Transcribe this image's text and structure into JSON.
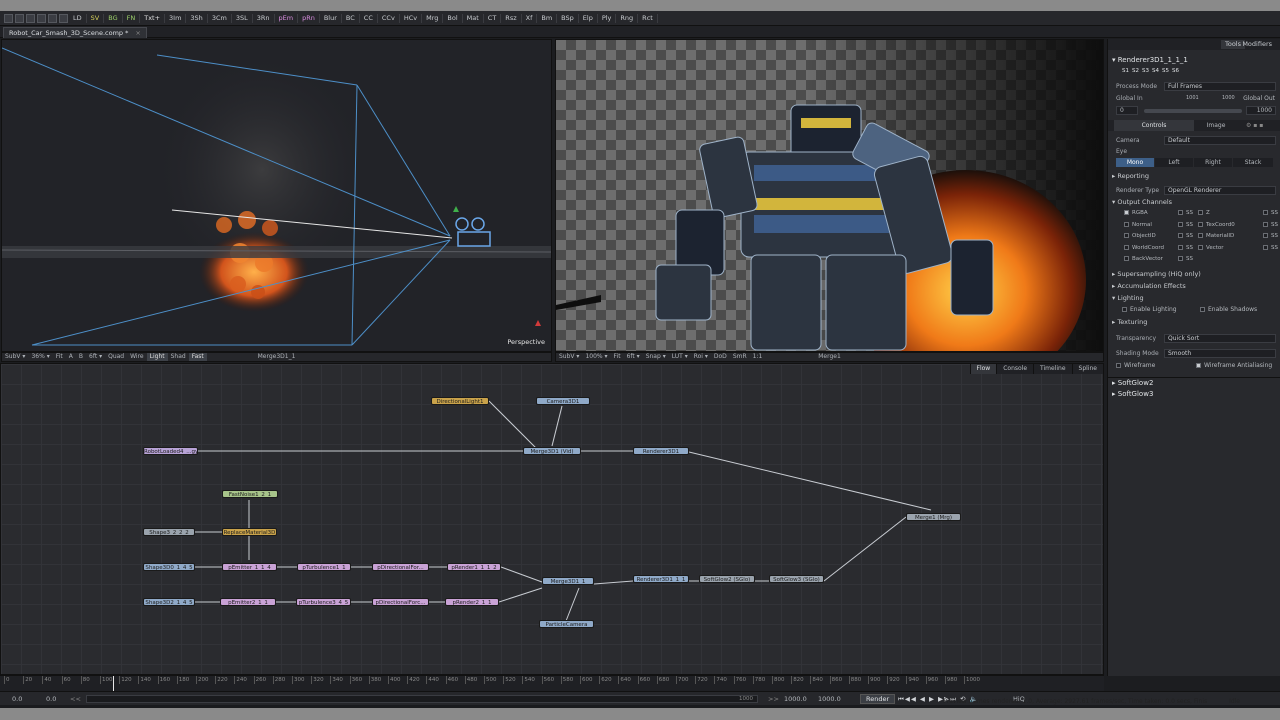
{
  "toolbar": {
    "items": [
      "LD",
      "SV",
      "BG",
      "FN",
      "Txt+",
      "3Im",
      "3Sh",
      "3Cm",
      "3SL",
      "3Rn",
      "pEm",
      "pRn",
      "Blur",
      "BC",
      "CC",
      "CCv",
      "HCv",
      "Mrg",
      "Bol",
      "Mat",
      "CT",
      "Rsz",
      "Xf",
      "Bm",
      "BSp",
      "Elp",
      "Ply",
      "Rng",
      "Rct"
    ]
  },
  "document_tab": {
    "title": "Robot_Car_Smash_3D_Scene.comp *",
    "close": "×"
  },
  "viewer_left": {
    "corner_label": "Perspective",
    "bar": {
      "items": [
        "SubV ▾",
        "36% ▾",
        "Fit",
        "A",
        "B",
        "6ft ▾",
        "Quad",
        "Wire",
        "Light",
        "Shad",
        "Fast"
      ],
      "node": "Merge3D1_1"
    }
  },
  "viewer_right": {
    "bar": {
      "items": [
        "SubV ▾",
        "100% ▾",
        "Fit",
        "6ft ▾",
        "Snap ▾",
        "LUT ▾",
        "Roi ▾",
        "DoD",
        "SmR",
        "1:1"
      ],
      "node": "Merge1"
    }
  },
  "inspector": {
    "tabs": {
      "tools": "Tools",
      "modifiers": "Modifiers"
    },
    "node_name": "Renderer3D1_1_1_1",
    "slots": [
      "S1",
      "S2",
      "S3",
      "S4",
      "S5",
      "S6"
    ],
    "process_mode_label": "Process Mode",
    "process_mode_value": "Full Frames",
    "global_in_label": "Global In",
    "global_out_label": "Global Out",
    "range_start": "0",
    "range_mid": "1001",
    "range_right": "1000",
    "range_end": "1000",
    "sub_tabs": {
      "controls": "Controls",
      "image": "Image"
    },
    "camera_label": "Camera",
    "camera_value": "Default",
    "eye_label": "Eye",
    "eye_options": [
      "Mono",
      "Left",
      "Right",
      "Stack"
    ],
    "reporting": "Reporting",
    "renderer_type_label": "Renderer Type",
    "renderer_type_value": "OpenGL Renderer",
    "output_channels": "Output Channels",
    "channels": [
      [
        "RGBA",
        "SS",
        "Z",
        "SS"
      ],
      [
        "Normal",
        "SS",
        "TexCoord0",
        "SS"
      ],
      [
        "ObjectID",
        "SS",
        "MaterialID",
        "SS"
      ],
      [
        "WorldCoord",
        "SS",
        "Vector",
        "SS"
      ],
      [
        "BackVector",
        "SS",
        "",
        ""
      ]
    ],
    "supersampling": "Supersampling (HiQ only)",
    "accumulation": "Accumulation Effects",
    "lighting": "Lighting",
    "enable_lighting": "Enable Lighting",
    "enable_shadows": "Enable Shadows",
    "texturing": "Texturing",
    "transparency_label": "Transparency",
    "transparency_value": "Quick Sort",
    "shading_label": "Shading Mode",
    "shading_value": "Smooth",
    "wireframe": "Wireframe",
    "wireframe_aa": "Wireframe Antialiasing",
    "other_tools": [
      "SoftGlow2",
      "SoftGlow3"
    ]
  },
  "node_editor": {
    "tabs": [
      "Flow",
      "Console",
      "Timeline",
      "Spline"
    ],
    "nodes": [
      {
        "label": "DirectionalLight1",
        "color": "#c9a24a"
      },
      {
        "label": "Camera3D1",
        "color": "#8fa9c8"
      },
      {
        "label": "RobotLoaded4_...gy",
        "color": "#b7a2d6"
      },
      {
        "label": "Merge3D1 (Vid)",
        "color": "#8fa9c8"
      },
      {
        "label": "Renderer3D1",
        "color": "#8fa9c8"
      },
      {
        "label": "FastNoise1_2_1",
        "color": "#a7c48a"
      },
      {
        "label": "Shape3_2_2_2",
        "color": "#9aa3ad"
      },
      {
        "label": "ReplaceMaterial3D",
        "color": "#c9a24a"
      },
      {
        "label": "Merge1 (Mrg)",
        "color": "#9aa3ad"
      },
      {
        "label": "Shape3D0_1_4_5",
        "color": "#8fa9c8"
      },
      {
        "label": "pEmitter_1_1_4",
        "color": "#c9a2d6"
      },
      {
        "label": "pTurbulence1_1",
        "color": "#c9a2d6"
      },
      {
        "label": "pDirectionalFor...",
        "color": "#c9a2d6"
      },
      {
        "label": "pRender1_1_1_2",
        "color": "#c9a2d6"
      },
      {
        "label": "Merge3D1_1",
        "color": "#8fa9c8"
      },
      {
        "label": "Renderer3D1_1_1",
        "color": "#8fa9c8"
      },
      {
        "label": "SoftGlow2 (SGlo)",
        "color": "#9aa3ad"
      },
      {
        "label": "SoftGlow3 (SGlo)",
        "color": "#9aa3ad"
      },
      {
        "label": "Shape3D2_1_4_5",
        "color": "#8fa9c8"
      },
      {
        "label": "pEmitter2_1_1",
        "color": "#c9a2d6"
      },
      {
        "label": "pTurbulence3_4_5",
        "color": "#c9a2d6"
      },
      {
        "label": "pDirectionalForc...",
        "color": "#c9a2d6"
      },
      {
        "label": "pRender2_1_1",
        "color": "#c9a2d6"
      },
      {
        "label": "ParticleCamera",
        "color": "#8fa9c8"
      }
    ]
  },
  "ruler": {
    "ticks": [
      "0",
      "20",
      "40",
      "60",
      "80",
      "100",
      "120",
      "140",
      "160",
      "180",
      "200",
      "220",
      "240",
      "260",
      "280",
      "300",
      "320",
      "340",
      "360",
      "380",
      "400",
      "420",
      "440",
      "460",
      "480",
      "500",
      "520",
      "540",
      "560",
      "580",
      "600",
      "620",
      "640",
      "660",
      "680",
      "700",
      "720",
      "740",
      "760",
      "780",
      "800",
      "820",
      "840",
      "860",
      "880",
      "900",
      "920",
      "940",
      "960",
      "980",
      "1000"
    ]
  },
  "transport": {
    "left1": "0.0",
    "left2": "0.0",
    "slider_end": "1000",
    "right1": "1000.0",
    "right2": "1000.0",
    "render": "Render",
    "hiq": "HiQ",
    "status": "Preview frames rendered: 1.0,  Average: 2927.61 frames/sec,  Time taken: 0.0 secs,  Finis",
    "idle": "Idle"
  },
  "colors": {
    "accent": "#e0453b",
    "panel": "#28292d",
    "bg": "#1c1d20"
  }
}
